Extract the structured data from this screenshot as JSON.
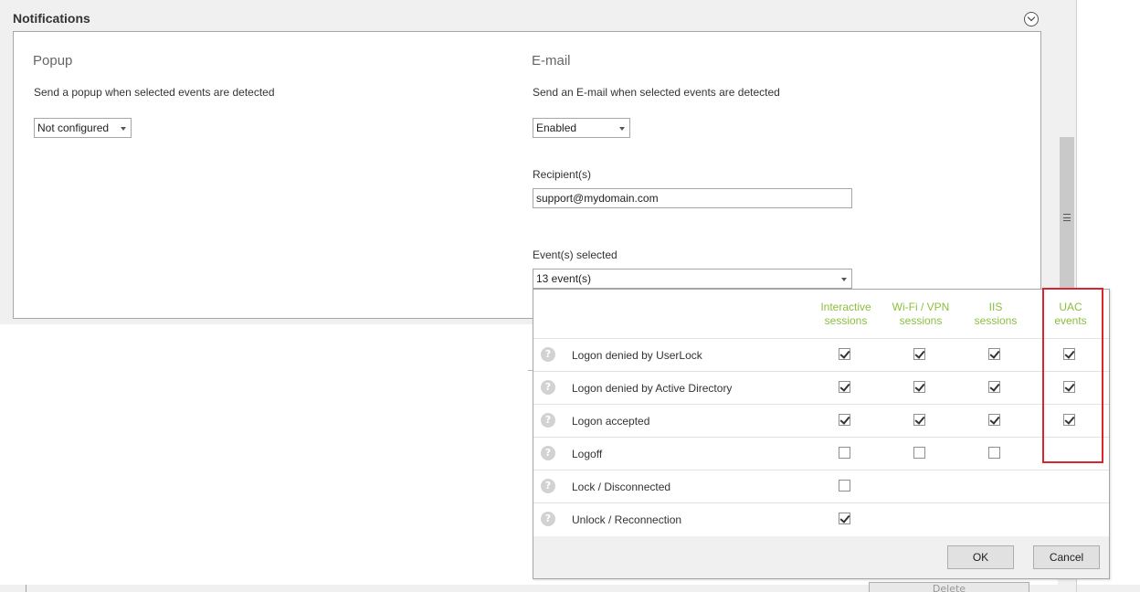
{
  "section": {
    "title": "Notifications"
  },
  "popup": {
    "heading": "Popup",
    "description": "Send a popup when selected events are detected",
    "selected": "Not configured"
  },
  "email": {
    "heading": "E-mail",
    "description": "Send an E-mail when selected events are detected",
    "selected": "Enabled",
    "recipients_label": "Recipient(s)",
    "recipients_value": "support@mydomain.com",
    "events_label": "Event(s) selected",
    "events_value": "13 event(s)"
  },
  "events_table": {
    "columns": [
      [
        "Interactive",
        "sessions"
      ],
      [
        "Wi-Fi / VPN",
        "sessions"
      ],
      [
        "IIS",
        "sessions"
      ],
      [
        "UAC",
        "events"
      ]
    ],
    "rows": [
      {
        "label": "Logon denied by UserLock",
        "checks": [
          true,
          true,
          true,
          true
        ]
      },
      {
        "label": "Logon denied by Active Directory",
        "checks": [
          true,
          true,
          true,
          true
        ]
      },
      {
        "label": "Logon accepted",
        "checks": [
          true,
          true,
          true,
          true
        ]
      },
      {
        "label": "Logoff",
        "checks": [
          false,
          false,
          false,
          null
        ]
      },
      {
        "label": "Lock / Disconnected",
        "checks": [
          false,
          null,
          null,
          null
        ]
      },
      {
        "label": "Unlock / Reconnection",
        "checks": [
          true,
          null,
          null,
          null
        ]
      }
    ],
    "ok_label": "OK",
    "cancel_label": "Cancel",
    "help_glyph": "?"
  },
  "background": {
    "delete_label": "Delete"
  },
  "colors": {
    "column_header": "#8bbf3f",
    "highlight": "#d9262c"
  },
  "icons": [
    "collapse-chevron-icon",
    "dropdown-arrow-icon",
    "help-icon",
    "checkbox-icon",
    "scrollbar-grip-icon"
  ]
}
